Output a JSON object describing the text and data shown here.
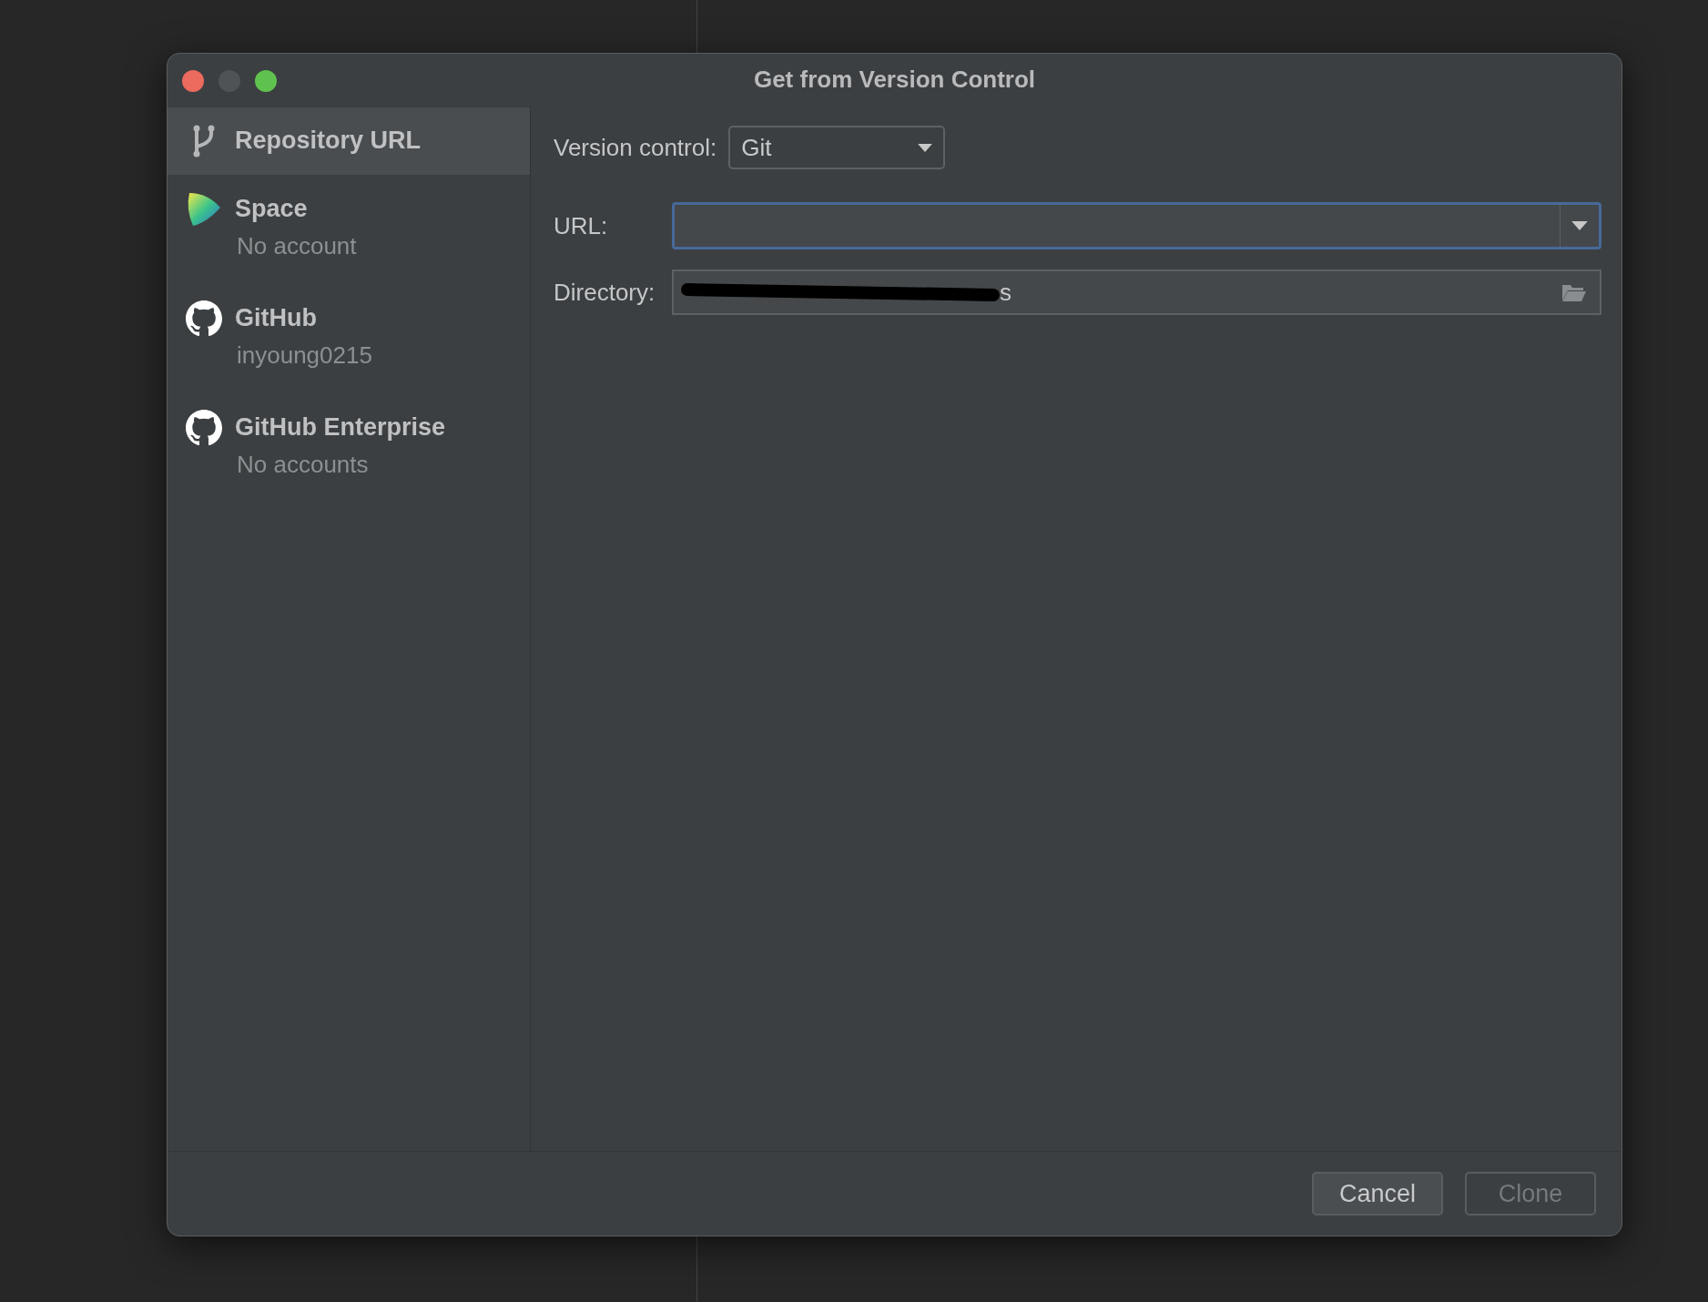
{
  "window": {
    "title": "Get from Version Control"
  },
  "sidebar": {
    "items": [
      {
        "kind": "url",
        "title": "Repository URL",
        "selected": true
      },
      {
        "kind": "space",
        "title": "Space",
        "subtitle": "No account",
        "selected": false
      },
      {
        "kind": "github",
        "title": "GitHub",
        "subtitle": "inyoung0215",
        "selected": false
      },
      {
        "kind": "github",
        "title": "GitHub Enterprise",
        "subtitle": "No accounts",
        "selected": false
      }
    ]
  },
  "form": {
    "version_control": {
      "label": "Version control:",
      "value": "Git"
    },
    "url": {
      "label": "URL:",
      "focused": true
    },
    "directory": {
      "label": "Directory:",
      "value": "s",
      "redacted": true
    }
  },
  "buttons": [
    {
      "label": "Cancel",
      "disabled": false
    },
    {
      "label": "Clone",
      "disabled": true
    }
  ]
}
